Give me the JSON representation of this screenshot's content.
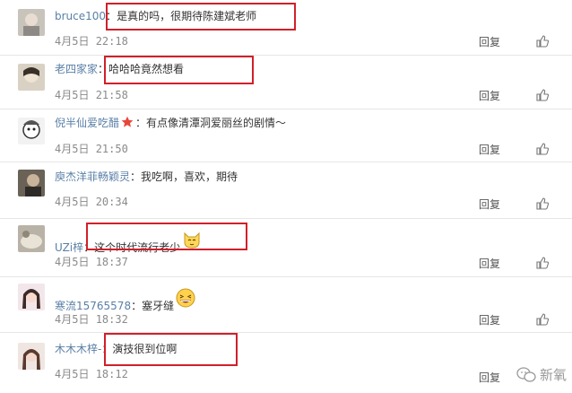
{
  "comments": [
    {
      "user": "bruce100",
      "text": "是真的吗，很期待陈建斌老师",
      "date": "4月5日",
      "time": "22:18",
      "reply": "回复",
      "highlighted": true,
      "emoji": null,
      "star": false
    },
    {
      "user": "老四家家",
      "text": "哈哈哈竟然想看",
      "date": "4月5日",
      "time": "21:58",
      "reply": "回复",
      "highlighted": true,
      "emoji": null,
      "star": false
    },
    {
      "user": "倪半仙爱吃醋",
      "text": "有点像清潭洞爱丽丝的剧情～",
      "date": "4月5日",
      "time": "21:50",
      "reply": "回复",
      "highlighted": false,
      "emoji": null,
      "star": true
    },
    {
      "user": "庾杰洋菲畅颖灵",
      "text": "我吃啊，喜欢，期待",
      "date": "4月5日",
      "time": "20:34",
      "reply": "回复",
      "highlighted": false,
      "emoji": null,
      "star": false
    },
    {
      "user": "UZi梓",
      "text": "这个时代流行老少",
      "date": "4月5日",
      "time": "18:37",
      "reply": "回复",
      "highlighted": true,
      "emoji": "cat-face-emoji",
      "star": false
    },
    {
      "user": "寒流15765578",
      "text": "塞牙缝",
      "date": "4月5日",
      "time": "18:32",
      "reply": "回复",
      "highlighted": false,
      "emoji": "laughing-face-emoji",
      "star": false
    },
    {
      "user": "木木木梓-",
      "text": "演技很到位啊",
      "date": "4月5日",
      "time": "18:12",
      "reply": "回复",
      "highlighted": true,
      "emoji": null,
      "star": false
    }
  ],
  "watermark": {
    "text": "新氧"
  },
  "colors": {
    "username": "#5a7fa6",
    "highlight_box": "#d0202a",
    "meta": "#8a8a8a"
  }
}
